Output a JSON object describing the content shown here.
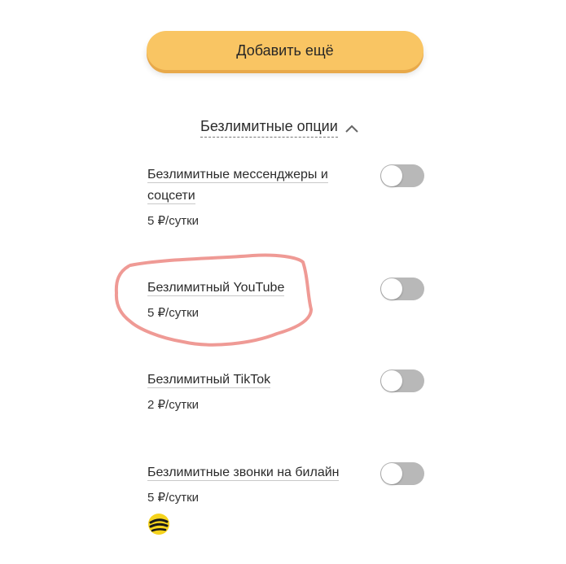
{
  "add_button": {
    "label": "Добавить ещё"
  },
  "section": {
    "title": "Безлимитные опции"
  },
  "options": [
    {
      "name_line1": "Безлимитные мессенджеры и",
      "name_line2": "соцсети",
      "price": "5 ₽/сутки",
      "enabled": false
    },
    {
      "name_line1": "Безлимитный YouTube",
      "name_line2": "",
      "price": "5 ₽/сутки",
      "enabled": false
    },
    {
      "name_line1": "Безлимитный TikTok",
      "name_line2": "",
      "price": "2 ₽/сутки",
      "enabled": false
    },
    {
      "name_line1": "Безлимитные звонки на билайн",
      "name_line2": "",
      "price": "5 ₽/сутки",
      "enabled": false
    }
  ],
  "colors": {
    "button_bg": "#f9c563",
    "toggle_off": "#b8b8b8",
    "annotation": "#ef9a95",
    "logo_yellow": "#f5d31d"
  },
  "icons": {
    "chevron": "chevron-up-icon",
    "logo": "beeline-logo-icon"
  }
}
